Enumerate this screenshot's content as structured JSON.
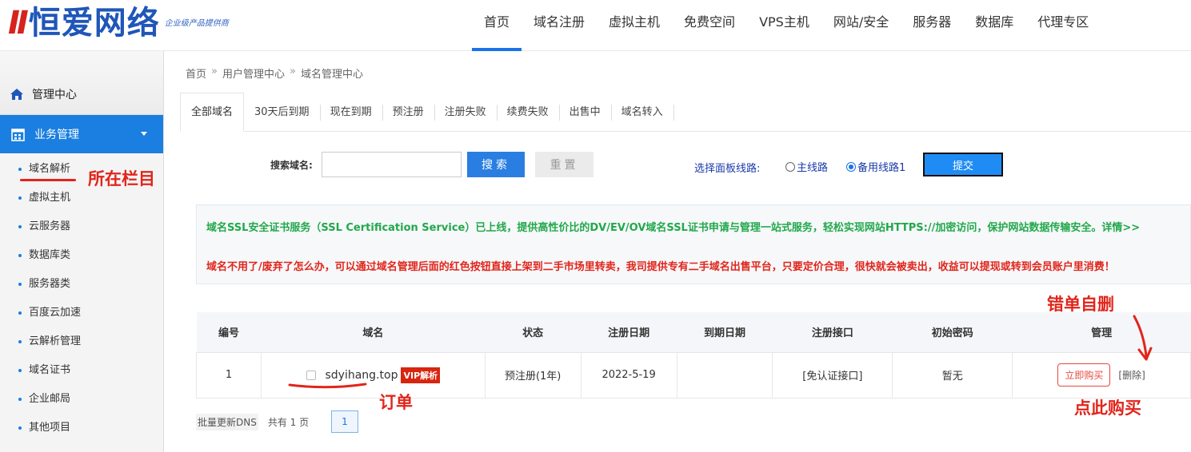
{
  "header": {
    "logo_mark": "II",
    "logo_text": "恒爱网络",
    "logo_sub": "企业级产品提供商",
    "nav": [
      "首页",
      "域名注册",
      "虚拟主机",
      "免费空间",
      "VPS主机",
      "网站/安全",
      "服务器",
      "数据库",
      "代理专区"
    ],
    "active_nav": "首页"
  },
  "sidebar": {
    "top_label": "管理中心",
    "section_label": "业务管理",
    "items": [
      "域名解析",
      "虚拟主机",
      "云服务器",
      "数据库类",
      "服务器类",
      "百度云加速",
      "云解析管理",
      "域名证书",
      "企业邮局",
      "其他项目"
    ]
  },
  "breadcrumb": [
    "首页",
    "用户管理中心",
    "域名管理中心"
  ],
  "breadcrumb_sep": "»",
  "tabs": [
    "全部域名",
    "30天后到期",
    "现在到期",
    "预注册",
    "注册失败",
    "续费失败",
    "出售中",
    "域名转入"
  ],
  "search": {
    "label": "搜索域名:",
    "value": "",
    "search_button": "搜索",
    "reset_button": "重置"
  },
  "line_select": {
    "label": "选择面板线路:",
    "options": [
      "主线路",
      "备用线路1"
    ],
    "selected": "备用线路1",
    "submit_button": "提交"
  },
  "notices": [
    "域名SSL安全证书服务（SSL Certification Service）已上线，提供高性价比的DV/EV/OV域名SSL证书申请与管理一站式服务，轻松实现网站HTTPS://加密访问，保护网站数据传输安全。详情>>",
    "域名不用了/废弃了怎么办，可以通过域名管理后面的红色按钮直接上架到二手市场里转卖，我司提供专有二手域名出售平台，只要定价合理，很快就会被卖出，收益可以提现或转到会员账户里消费！"
  ],
  "table": {
    "headers": [
      "编号",
      "域名",
      "状态",
      "注册日期",
      "到期日期",
      "注册接口",
      "初始密码",
      "管理"
    ],
    "rows": [
      {
        "id": "1",
        "domain": "sdyihang.top",
        "badge": "VIP解析",
        "status": "预注册(1年)",
        "reg_date": "2022-5-19",
        "exp_date": "",
        "interface": "[免认证接口]",
        "password": "暂无",
        "buy_button": "立即购买",
        "delete_link": "[删除]"
      }
    ]
  },
  "footer": {
    "batch_dns": "批量更新DNS",
    "total": "共有 1 页",
    "page": "1"
  },
  "annotations": {
    "column": "所在栏目",
    "order": "订单",
    "self_delete": "错单自删",
    "buy_here": "点此购买"
  },
  "colors": {
    "accent": "#1a7fe0",
    "annotation_red": "#e1251b",
    "notice_green": "#22a84b",
    "notice_red": "#e1251b"
  }
}
